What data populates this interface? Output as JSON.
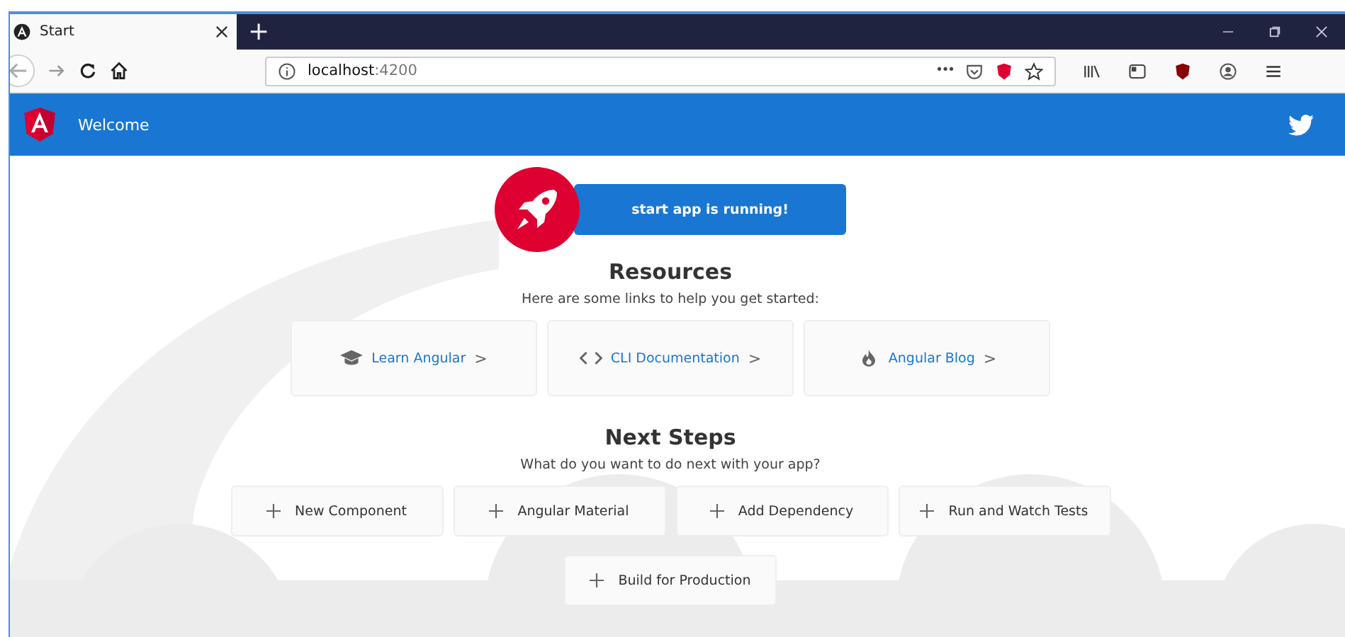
{
  "browser": {
    "tabs": [
      {
        "title": "Start",
        "selected": true
      }
    ],
    "new_tab": "+",
    "url": {
      "host": "localhost",
      "port": ":4200"
    },
    "page_actions": "•••"
  },
  "toolbar": {
    "title": "Welcome"
  },
  "banner": {
    "text": "start app is running!"
  },
  "resources": {
    "title": "Resources",
    "subtitle": "Here are some links to help you get started:",
    "links": [
      {
        "kind": "learn",
        "label": "Learn Angular",
        "chevron": ">"
      },
      {
        "kind": "cli",
        "label": "CLI Documentation",
        "chevron": ">"
      },
      {
        "kind": "blog",
        "label": "Angular Blog",
        "chevron": ">"
      }
    ]
  },
  "next_steps": {
    "title": "Next Steps",
    "subtitle": "What do you want to do next with your app?",
    "actions": [
      {
        "label": "New Component"
      },
      {
        "label": "Angular Material"
      },
      {
        "label": "Add Dependency"
      },
      {
        "label": "Run and Watch Tests"
      },
      {
        "label": "Build for Production"
      }
    ]
  }
}
